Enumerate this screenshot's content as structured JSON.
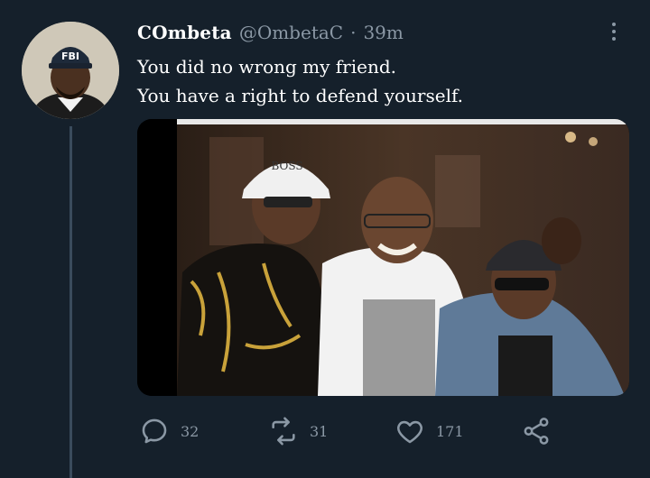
{
  "tweet": {
    "display_name": "COmbeta",
    "handle": "@OmbetaC",
    "separator": "·",
    "time": "39m",
    "lines": [
      "You did no wrong my friend.",
      "You have a right to defend yourself."
    ],
    "avatar_cap_text": "FBI",
    "photo_cap_text": "BOSS"
  },
  "actions": {
    "reply_count": "32",
    "retweet_count": "31",
    "like_count": "171"
  },
  "icons": {
    "reply": "reply-icon",
    "retweet": "retweet-icon",
    "like": "heart-icon",
    "share": "share-icon",
    "more": "more-icon"
  },
  "colors": {
    "background": "#15202b",
    "primary_text": "#ffffff",
    "secondary_text": "#8b98a5"
  }
}
